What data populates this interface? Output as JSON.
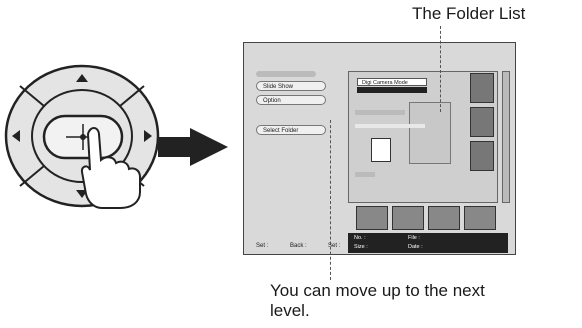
{
  "callouts": {
    "folder_list": "The Folder List",
    "up_level_line1": "You can move up to the next",
    "up_level_line2": "level."
  },
  "screen": {
    "menu": [
      "Slide Show",
      "Option",
      "Select Folder"
    ],
    "mode": "Digi Camera Mode",
    "info_labels": [
      "No. :",
      "File :",
      "Size :",
      "Date :"
    ],
    "footer": [
      "Set :",
      "Back :",
      "Set :"
    ]
  },
  "colors": {
    "ink": "#1a1a1a",
    "screen_bg": "#d9d9d9",
    "infobar": "#222222"
  }
}
